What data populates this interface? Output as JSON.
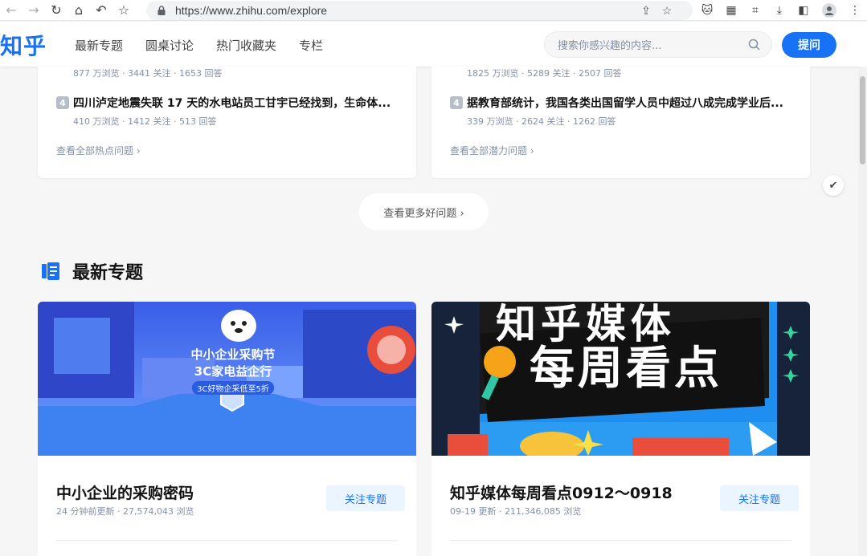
{
  "browser": {
    "url": "https://www.zhihu.com/explore"
  },
  "header": {
    "logo": "知乎",
    "nav": [
      "最新专题",
      "圆桌讨论",
      "热门收藏夹",
      "专栏"
    ],
    "search_placeholder": "搜索你感兴趣的内容...",
    "ask_label": "提问"
  },
  "hot_cards": [
    {
      "top_meta": "877 万浏览 · 3441 关注 · 1653 回答",
      "rank": "4",
      "question": "四川泸定地震失联 17 天的水电站员工甘宇已经找到，生命体...",
      "meta": "410 万浏览 · 1412 关注 · 513 回答",
      "more": "查看全部热点问题 ›"
    },
    {
      "top_meta": "1825 万浏览 · 5289 关注 · 2507 回答",
      "rank": "4",
      "question": "据教育部统计，我国各类出国留学人员中超过八成完成学业后...",
      "meta": "339 万浏览 · 2624 关注 · 1262 回答",
      "more": "查看全部潜力问题 ›"
    }
  ],
  "more_questions": "查看更多好问题 ›",
  "section_title": "最新专题",
  "topics": [
    {
      "banner_line1": "中小企业采购节",
      "banner_line2": "3C家电益企行",
      "banner_line3": "3C好物企采低至5折",
      "name": "中小企业的采购密码",
      "meta": "24 分钟前更新 · 27,574,043 浏览",
      "follow": "关注专题"
    },
    {
      "banner_line1": "知乎媒体",
      "banner_line2": "每周看点",
      "name": "知乎媒体每周看点0912～0918",
      "meta": "09-19 更新 · 211,346,085 浏览",
      "follow": "关注专题"
    }
  ],
  "colors": {
    "brand": "#1772f6",
    "meta": "#8590a6",
    "follow_bg": "#ebf5ff"
  }
}
